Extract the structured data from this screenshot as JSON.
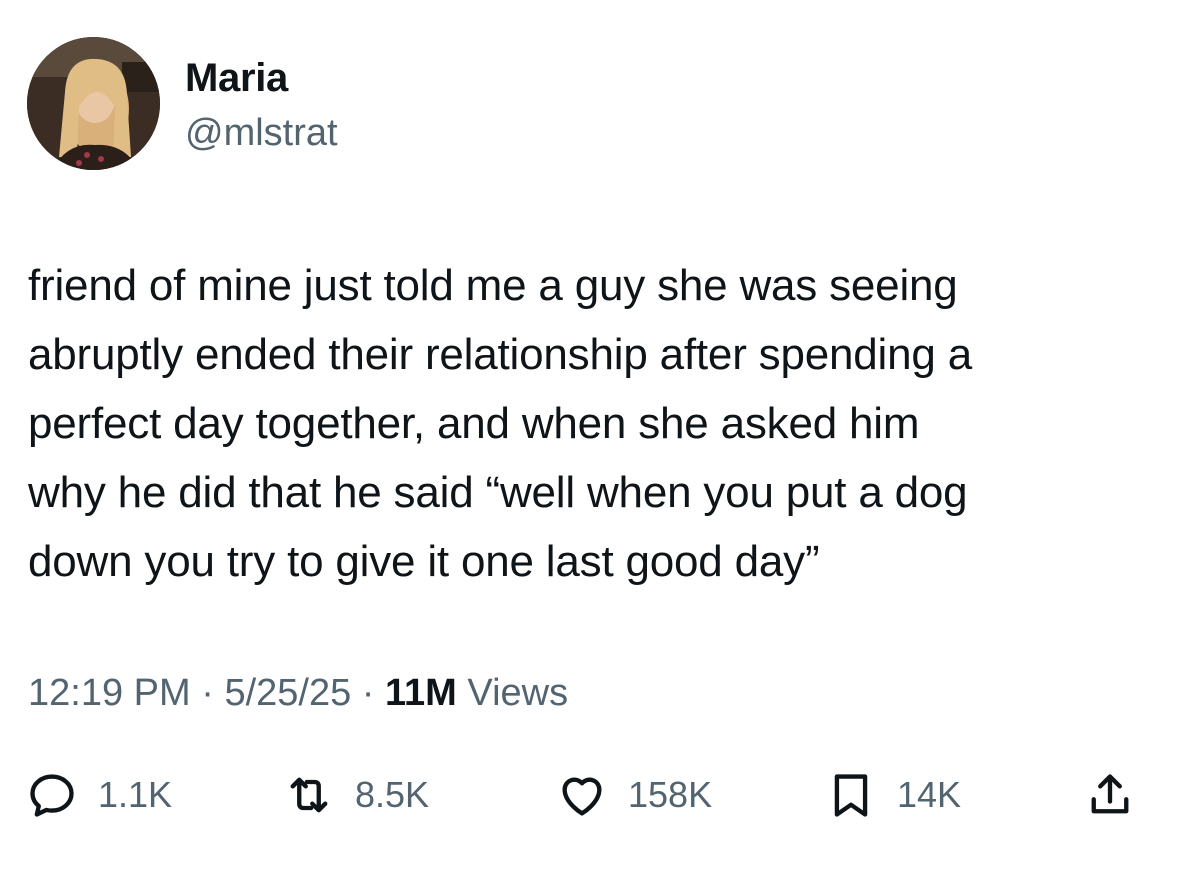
{
  "author": {
    "display_name": "Maria",
    "handle": "@mlstrat"
  },
  "tweet": {
    "lines": [
      "friend of mine just told me a guy she was seeing",
      "abruptly ended their relationship after spending a",
      "perfect day together, and when she asked him",
      "why he did that he said “well when you put a dog",
      "down you try to give it one last good day”"
    ]
  },
  "meta": {
    "time": "12:19 PM",
    "separator": " · ",
    "date": "5/25/25",
    "views_count": "11M",
    "views_label": "Views"
  },
  "actions": {
    "replies": "1.1K",
    "reposts": "8.5K",
    "likes": "158K",
    "bookmarks": "14K"
  },
  "icons": {
    "reply": "reply-icon",
    "repost": "repost-icon",
    "like": "heart-icon",
    "bookmark": "bookmark-icon",
    "share": "share-icon"
  },
  "colors": {
    "text_primary": "#0f1419",
    "text_secondary": "#536471",
    "icon": "#536471",
    "background": "#ffffff"
  }
}
